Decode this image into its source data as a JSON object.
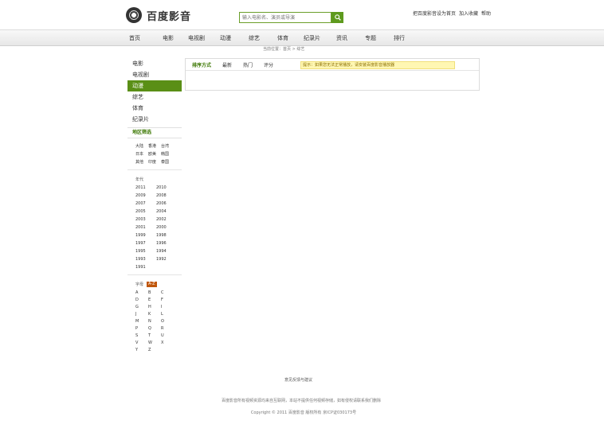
{
  "header": {
    "logo_text": "百度影音",
    "search_placeholder": "输入电影名、演员或导演",
    "top_links": [
      "把百度影音设为首页",
      "加入收藏",
      "帮助"
    ]
  },
  "nav": {
    "items": [
      "首页",
      "电影",
      "电视剧",
      "动漫",
      "综艺",
      "体育",
      "纪录片",
      "资讯",
      "专题",
      "排行"
    ]
  },
  "subtitle": "当前位置：首页 > 综艺",
  "sidebar": {
    "categories": [
      "电影",
      "电视剧",
      "动漫",
      "综艺",
      "体育",
      "纪录片"
    ],
    "active_index": 2,
    "region_title": "地区筛选",
    "regions": [
      "大陆",
      "香港",
      "台湾",
      "日本",
      "欧美",
      "韩国",
      "其他",
      "印度",
      "泰国"
    ],
    "year_title": "年代",
    "years": [
      "2011",
      "2010",
      "2009",
      "2008",
      "2007",
      "2006",
      "2005",
      "2004",
      "2003",
      "2002",
      "2001",
      "2000",
      "1999",
      "1998",
      "1997",
      "1996",
      "1995",
      "1994",
      "1993",
      "1992",
      "1991"
    ],
    "letter_title": "字母",
    "letter_tag": "A-Z",
    "letters": [
      "A",
      "B",
      "C",
      "D",
      "E",
      "F",
      "G",
      "H",
      "I",
      "J",
      "K",
      "L",
      "M",
      "N",
      "O",
      "P",
      "Q",
      "R",
      "S",
      "T",
      "U",
      "V",
      "W",
      "X",
      "Y",
      "Z"
    ]
  },
  "content": {
    "sort_label": "排序方式",
    "tabs": [
      "最新",
      "热门",
      "评分"
    ],
    "notice": "提示：如果您无法正常播放，请安装百度影音播放器"
  },
  "footer": {
    "link": "意见反馈与建议",
    "line1": "百度影音所有视频资源均来自互联网，本站不提供任何视频存储，如有侵权请联系我们删除",
    "line2": "Copyright © 2011 百度影音 版权所有 京ICP证030173号"
  }
}
